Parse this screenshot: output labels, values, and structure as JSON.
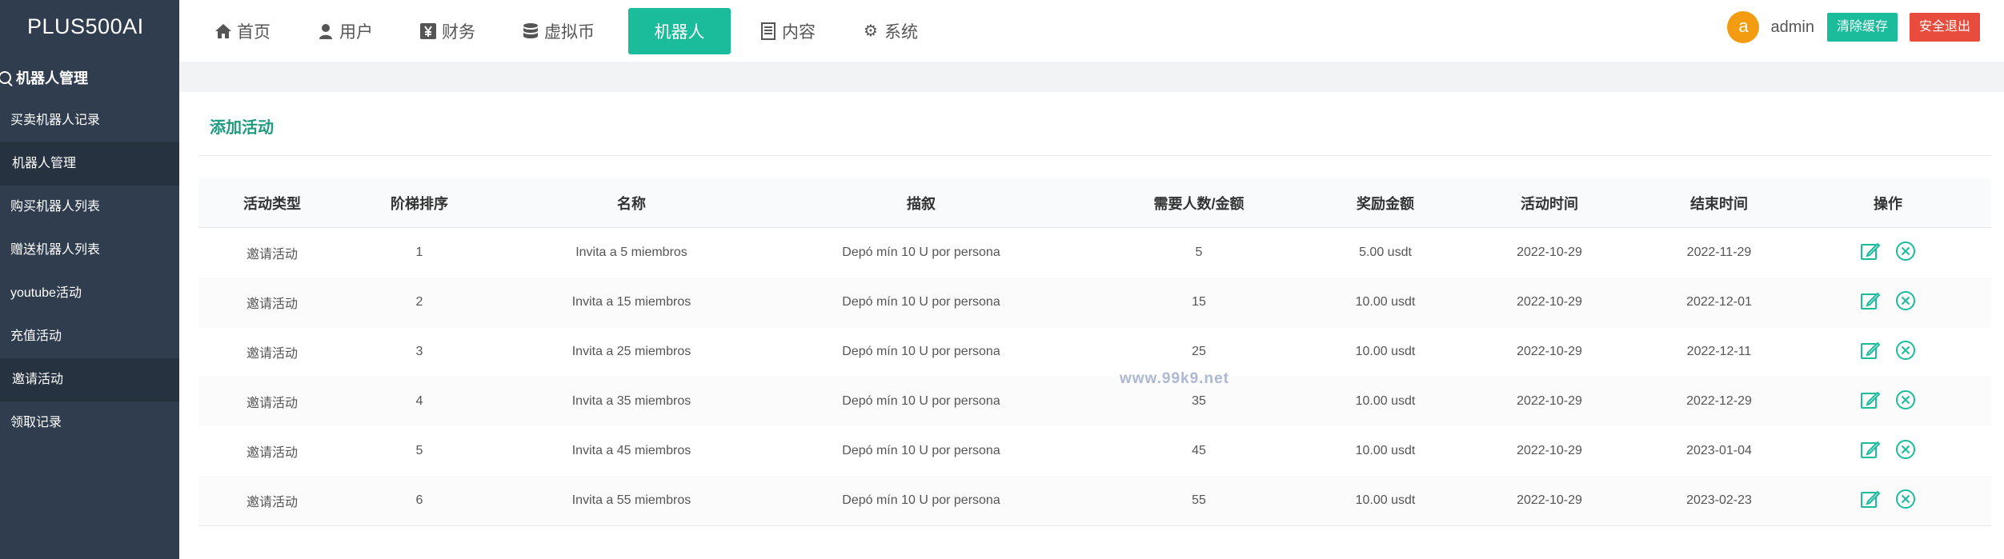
{
  "app": {
    "title": "PLUS500AI"
  },
  "sidebar": {
    "section_label": "机器人管理",
    "items": [
      {
        "label": "买卖机器人记录"
      },
      {
        "label": "机器人管理"
      },
      {
        "label": "购买机器人列表"
      },
      {
        "label": "赠送机器人列表"
      },
      {
        "label": "youtube活动"
      },
      {
        "label": "充值活动"
      },
      {
        "label": "邀请活动"
      },
      {
        "label": "领取记录"
      }
    ]
  },
  "nav": {
    "items": [
      {
        "label": "首页",
        "icon": "home-icon"
      },
      {
        "label": "用户",
        "icon": "user-icon"
      },
      {
        "label": "财务",
        "icon": "finance-icon"
      },
      {
        "label": "虚拟币",
        "icon": "database-icon"
      },
      {
        "label": "机器人",
        "icon": "robot-icon"
      },
      {
        "label": "内容",
        "icon": "document-icon"
      },
      {
        "label": "系统",
        "icon": "gear-icon"
      }
    ],
    "active": "机器人"
  },
  "user": {
    "avatar_letter": "a",
    "name": "admin"
  },
  "header_buttons": {
    "clear_cache": "清除缓存",
    "logout": "安全退出"
  },
  "page": {
    "add_label": "添加活动"
  },
  "table": {
    "headers": [
      "活动类型",
      "阶梯排序",
      "名称",
      "描叙",
      "需要人数/金额",
      "奖励金额",
      "活动时间",
      "结束时间",
      "操作"
    ],
    "rows": [
      [
        "邀请活动",
        "1",
        "Invita a 5 miembros",
        "Depó mín 10 U por persona",
        "5",
        "5.00 usdt",
        "2022-10-29",
        "2022-11-29"
      ],
      [
        "邀请活动",
        "2",
        "Invita a 15 miembros",
        "Depó mín 10 U por persona",
        "15",
        "10.00 usdt",
        "2022-10-29",
        "2022-12-01"
      ],
      [
        "邀请活动",
        "3",
        "Invita a 25 miembros",
        "Depó mín 10 U por persona",
        "25",
        "10.00 usdt",
        "2022-10-29",
        "2022-12-11"
      ],
      [
        "邀请活动",
        "4",
        "Invita a 35 miembros",
        "Depó mín 10 U por persona",
        "35",
        "10.00 usdt",
        "2022-10-29",
        "2022-12-29"
      ],
      [
        "邀请活动",
        "5",
        "Invita a 45 miembros",
        "Depó mín 10 U por persona",
        "45",
        "10.00 usdt",
        "2022-10-29",
        "2023-01-04"
      ],
      [
        "邀请活动",
        "6",
        "Invita a 55 miembros",
        "Depó mín 10 U por persona",
        "55",
        "10.00 usdt",
        "2022-10-29",
        "2023-02-23"
      ]
    ]
  },
  "watermark": "www.99k9.net",
  "colors": {
    "sidebar": "#2f3d4e",
    "accent": "#1abc9c",
    "danger": "#e74c3c",
    "avatar": "#f39c12"
  }
}
